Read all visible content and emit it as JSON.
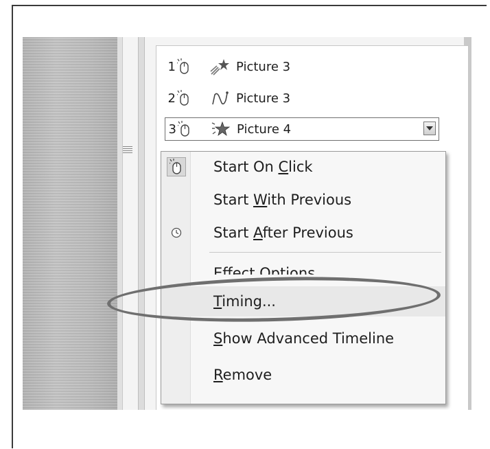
{
  "animation_list": {
    "items": [
      {
        "number": "1",
        "effect_icon": "fly-in-star-icon",
        "name": "Picture 3"
      },
      {
        "number": "2",
        "effect_icon": "motion-path-icon",
        "name": "Picture 3"
      },
      {
        "number": "3",
        "effect_icon": "sparkle-star-icon",
        "name": "Picture 4",
        "selected": true
      }
    ]
  },
  "context_menu": {
    "items": [
      {
        "pre": "Start On ",
        "key": "C",
        "post": "lick",
        "icon": "mouse-click-icon",
        "checked": true
      },
      {
        "pre": "Start ",
        "key": "W",
        "post": "ith Previous"
      },
      {
        "pre": "Start ",
        "key": "A",
        "post": "fter Previous",
        "icon": "clock-icon"
      },
      {
        "pre": "Effect Options",
        "key": "",
        "post": "..."
      },
      {
        "pre": "",
        "key": "T",
        "post": "iming...",
        "highlighted": true
      },
      {
        "pre": "",
        "key": "S",
        "post": "how Advanced Timeline"
      },
      {
        "pre": "",
        "key": "R",
        "post": "emove"
      }
    ]
  },
  "annotation": {
    "color": "#6f6f6f",
    "shape": "ellipse",
    "target": "Timing..."
  }
}
